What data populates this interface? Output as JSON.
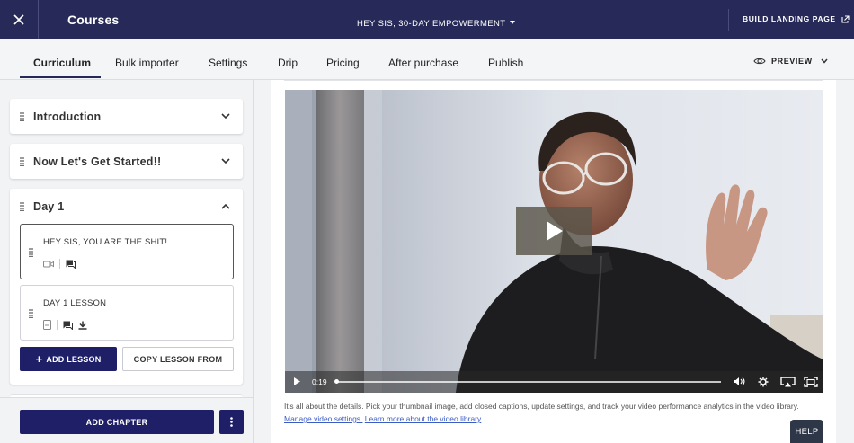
{
  "header": {
    "close_icon": "close-icon",
    "title": "Courses",
    "course_name": "HEY SIS, 30-DAY EMPOWERMENT",
    "build_landing_page": "BUILD LANDING PAGE",
    "bg_color": "#272a58"
  },
  "tabs": [
    {
      "label": "Curriculum",
      "active": true
    },
    {
      "label": "Bulk importer"
    },
    {
      "label": "Settings"
    },
    {
      "label": "Drip"
    },
    {
      "label": "Pricing"
    },
    {
      "label": "After purchase"
    },
    {
      "label": "Publish"
    }
  ],
  "preview": {
    "label": "PREVIEW"
  },
  "sidebar": {
    "chapters": [
      {
        "title": "Introduction",
        "expanded": false
      },
      {
        "title": "Now Let's Get Started!!",
        "expanded": false
      },
      {
        "title": "Day 1",
        "expanded": true
      }
    ],
    "lessons": [
      {
        "title": "HEY SIS, YOU ARE THE SHIT!",
        "selected": true,
        "icons": [
          "video-icon",
          "comment-icon"
        ]
      },
      {
        "title": "DAY 1 LESSON",
        "selected": false,
        "icons": [
          "text-icon",
          "comment-icon",
          "download-icon"
        ]
      }
    ],
    "add_lesson": "ADD LESSON",
    "copy_lesson": "COPY LESSON FROM",
    "add_chapter": "ADD CHAPTER",
    "accent_color": "#1e1f66"
  },
  "video": {
    "current_time": "0:19",
    "progress": 0.0
  },
  "caption": {
    "text": "It's all about the details. Pick your thumbnail image, add closed captions, update settings, and track your video performance analytics in the video library.",
    "link1": "Manage video settings.",
    "link2": "Learn more about the video library"
  },
  "help": {
    "label": "HELP"
  }
}
